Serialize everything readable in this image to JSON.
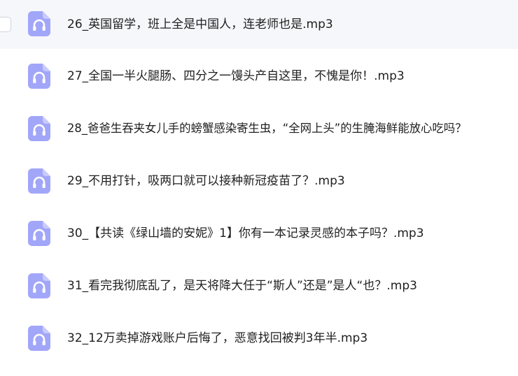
{
  "file_list": {
    "items": [
      {
        "name": "26_英国留学，班上全是中国人，连老师也是.mp3",
        "icon": "headphones-icon",
        "selected": true
      },
      {
        "name": "27_全国一半火腿肠、四分之一馒头产自这里，不愧是你！.mp3",
        "icon": "headphones-icon",
        "selected": false
      },
      {
        "name": "28_爸爸生吞夹女儿手的螃蟹感染寄生虫，“全网上头”的生腌海鲜能放心吃吗？",
        "icon": "headphones-icon",
        "selected": false
      },
      {
        "name": "29_不用打针，吸两口就可以接种新冠疫苗了？.mp3",
        "icon": "headphones-icon",
        "selected": false
      },
      {
        "name": "30_【共读《绿山墙的安妮》1】你有一本记录灵感的本子吗？.mp3",
        "icon": "headphones-icon",
        "selected": false
      },
      {
        "name": "31_看完我彻底乱了，是天将降大任于“斯人”还是”是人“也？.mp3",
        "icon": "headphones-icon",
        "selected": false
      },
      {
        "name": "32_12万卖掉游戏账户后悔了，恶意找回被判3年半.mp3",
        "icon": "headphones-icon",
        "selected": false
      }
    ]
  },
  "colors": {
    "icon_bg": "#a2a6f9",
    "icon_fold": "#c8cafc",
    "selected_row_bg": "#f6f7fb",
    "text": "#1f1f1f"
  }
}
